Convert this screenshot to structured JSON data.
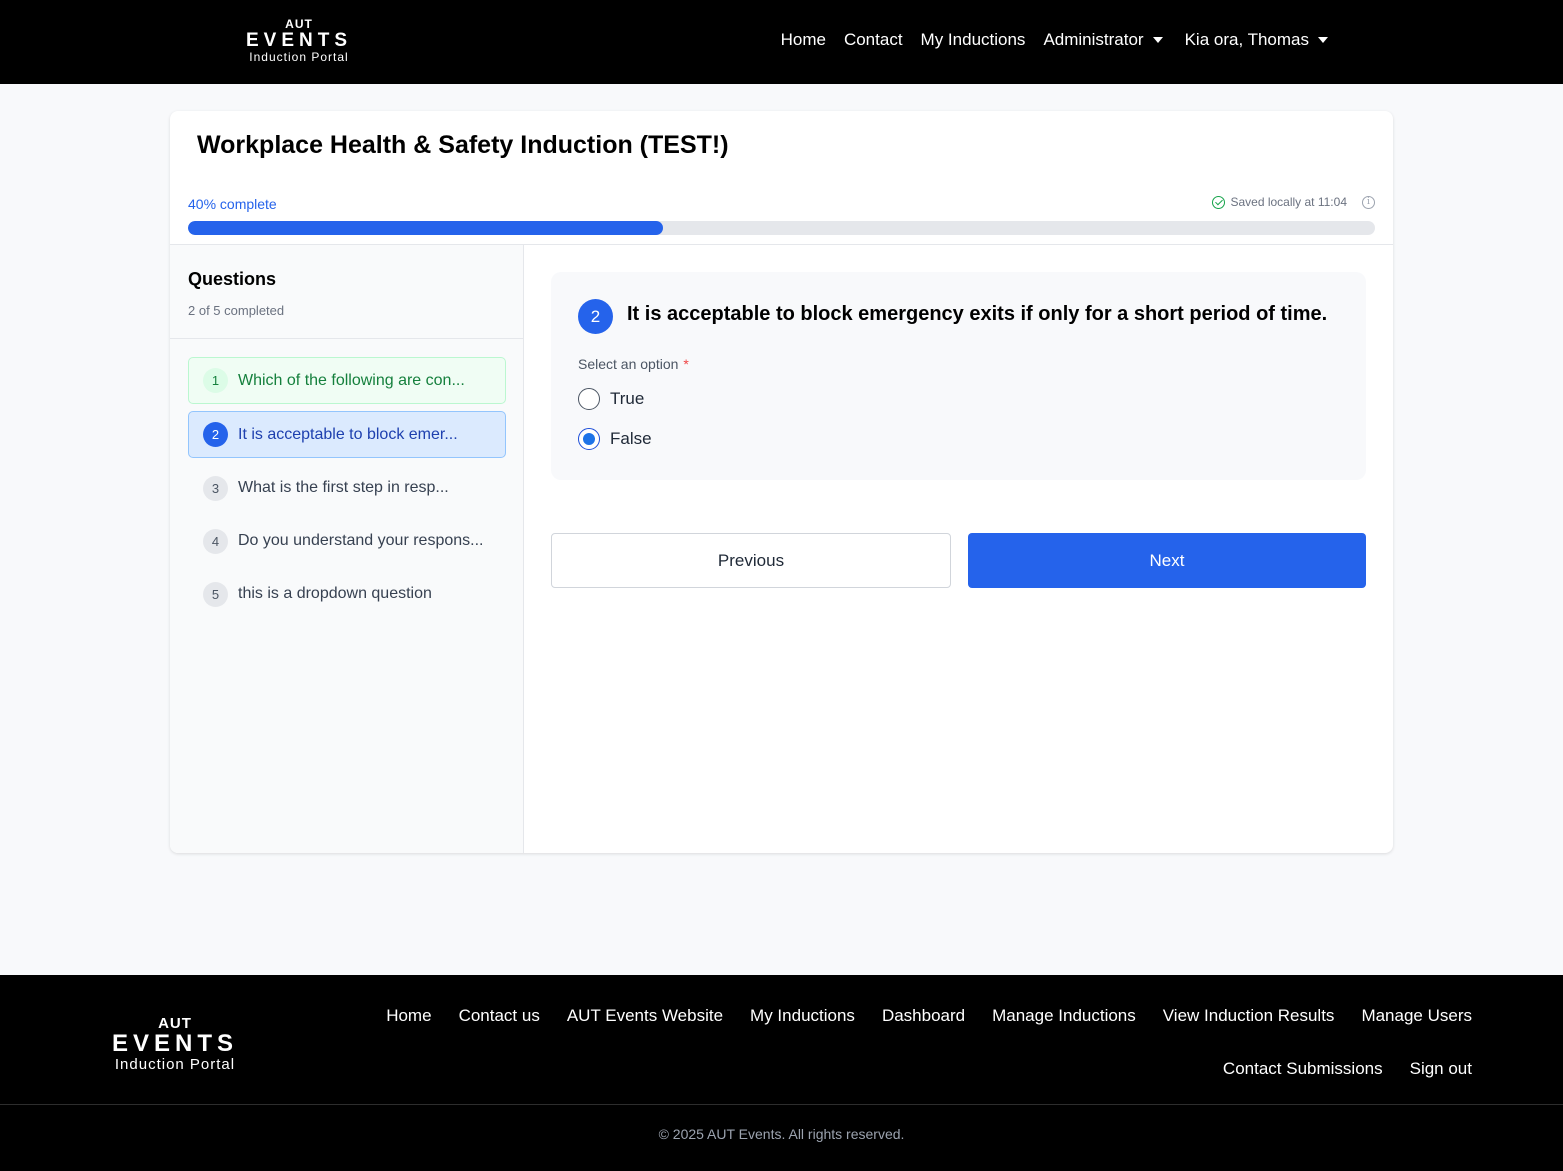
{
  "header": {
    "logo": {
      "line1": "AUT",
      "line2": "EVENTS",
      "line3": "Induction Portal"
    },
    "nav": {
      "home": "Home",
      "contact": "Contact",
      "my_inductions": "My Inductions",
      "administrator": "Administrator",
      "greeting": "Kia ora, Thomas"
    }
  },
  "induction": {
    "title": "Workplace Health & Safety Induction (TEST!)",
    "progress_label": "40% complete",
    "progress_fraction": 0.4,
    "saved_text": "Saved locally at 11:04"
  },
  "sidebar": {
    "title": "Questions",
    "subtitle": "2 of 5 completed",
    "items": [
      {
        "number": "1",
        "label": "Which of the following are con...",
        "state": "done"
      },
      {
        "number": "2",
        "label": "It is acceptable to block emer...",
        "state": "active"
      },
      {
        "number": "3",
        "label": "What is the first step in resp...",
        "state": "pending"
      },
      {
        "number": "4",
        "label": "Do you understand your respons...",
        "state": "pending"
      },
      {
        "number": "5",
        "label": "this is a dropdown question",
        "state": "pending"
      }
    ]
  },
  "question": {
    "number": "2",
    "text": "It is acceptable to block emergency exits if only for a short period of time.",
    "select_label": "Select an option",
    "required_mark": "*",
    "options": [
      {
        "label": "True",
        "selected": false
      },
      {
        "label": "False",
        "selected": true
      }
    ]
  },
  "buttons": {
    "previous": "Previous",
    "next": "Next"
  },
  "footer": {
    "logo": {
      "line1": "AUT",
      "line2": "EVENTS",
      "line3": "Induction Portal"
    },
    "links_row1": [
      "Home",
      "Contact us",
      "AUT Events Website",
      "My Inductions",
      "Dashboard",
      "Manage Inductions",
      "View Induction Results",
      "Manage Users"
    ],
    "links_row2": [
      "Contact Submissions",
      "Sign out"
    ],
    "copyright": "© 2025 AUT Events. All rights reserved."
  },
  "colors": {
    "accent": "#2563eb",
    "success": "#16a34a",
    "header_bg": "#000000"
  }
}
